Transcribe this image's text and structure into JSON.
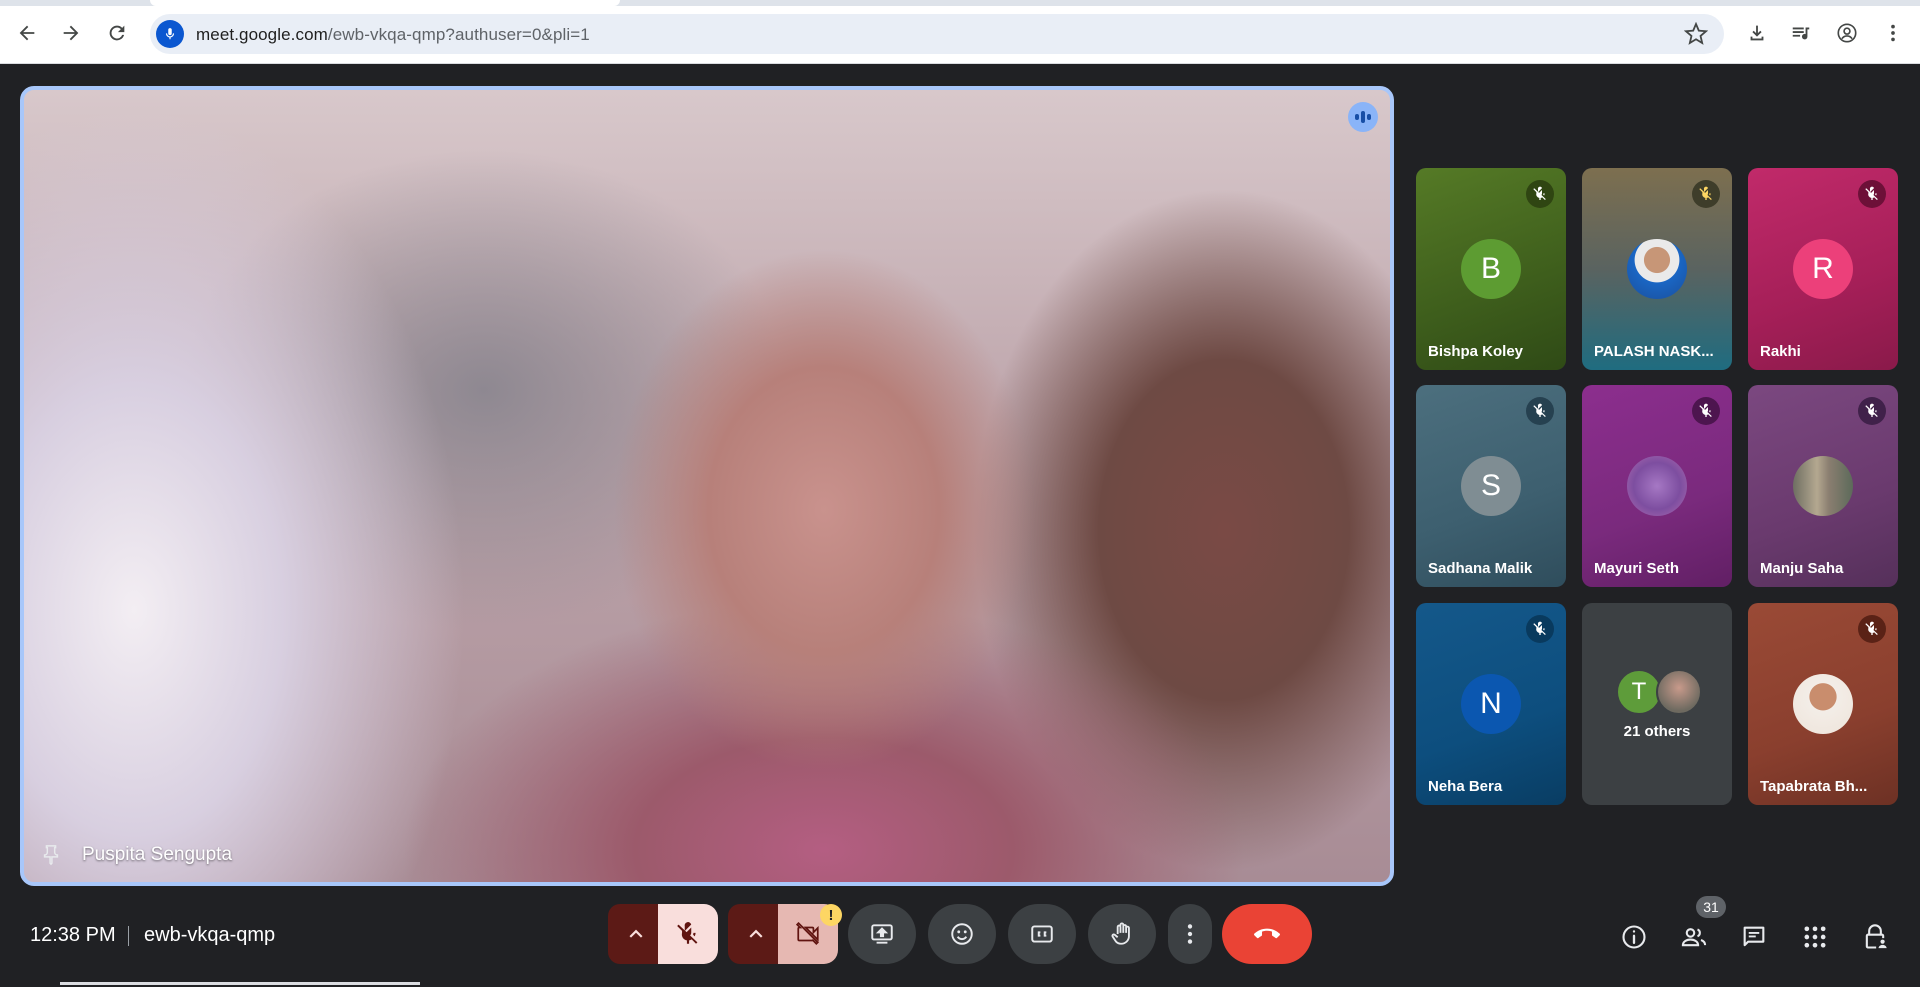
{
  "browser": {
    "url_host": "meet.google.com",
    "url_path": "/ewb-vkqa-qmp?authuser=0&pli=1"
  },
  "main_tile": {
    "participant_name": "Puspita Sengupta"
  },
  "participants": [
    {
      "name": "Bishpa Koley",
      "initial": "B",
      "bg": "#4a6b1f",
      "avatar_color": "#5d9c32",
      "mute_bg": "#2f4512"
    },
    {
      "name": "PALASH NASK...",
      "initial": "",
      "bg": "#6a6a55",
      "avatar_color": "",
      "mute_bg": "#3e3d2a"
    },
    {
      "name": "Rakhi",
      "initial": "R",
      "bg": "#b0225f",
      "avatar_color": "#ec407a",
      "mute_bg": "#6d1038"
    },
    {
      "name": "Sadhana Malik",
      "initial": "S",
      "bg": "#3d5f6f",
      "avatar_color": "#7f8d93",
      "mute_bg": "#264150"
    },
    {
      "name": "Mayuri Seth",
      "initial": "",
      "bg": "#7e2980",
      "avatar_color": "",
      "mute_bg": "#4d154f"
    },
    {
      "name": "Manju Saha",
      "initial": "",
      "bg": "#6a3a6e",
      "avatar_color": "",
      "mute_bg": "#40214a"
    },
    {
      "name": "Neha Bera",
      "initial": "N",
      "bg": "#0d4e7e",
      "avatar_color": "#0b57b0",
      "mute_bg": "#093a5e"
    },
    {
      "name": "21 others",
      "initial": "T",
      "bg": "#3c4043",
      "avatar_color": "#5e9c3a",
      "mute_bg": ""
    },
    {
      "name": "Tapabrata Bh...",
      "initial": "",
      "bg": "#8a3f2e",
      "avatar_color": "",
      "mute_bg": "#5a2216"
    }
  ],
  "bottom_bar": {
    "time": "12:38 PM",
    "meeting_code": "ewb-vkqa-qmp",
    "participant_count": "31",
    "camera_alert": "!"
  },
  "colors": {
    "end_call": "#ea4335",
    "mic_off_bg": "#f9dedc",
    "cam_off_bg": "#e6b8b2",
    "active_border": "#a8c7fa"
  }
}
